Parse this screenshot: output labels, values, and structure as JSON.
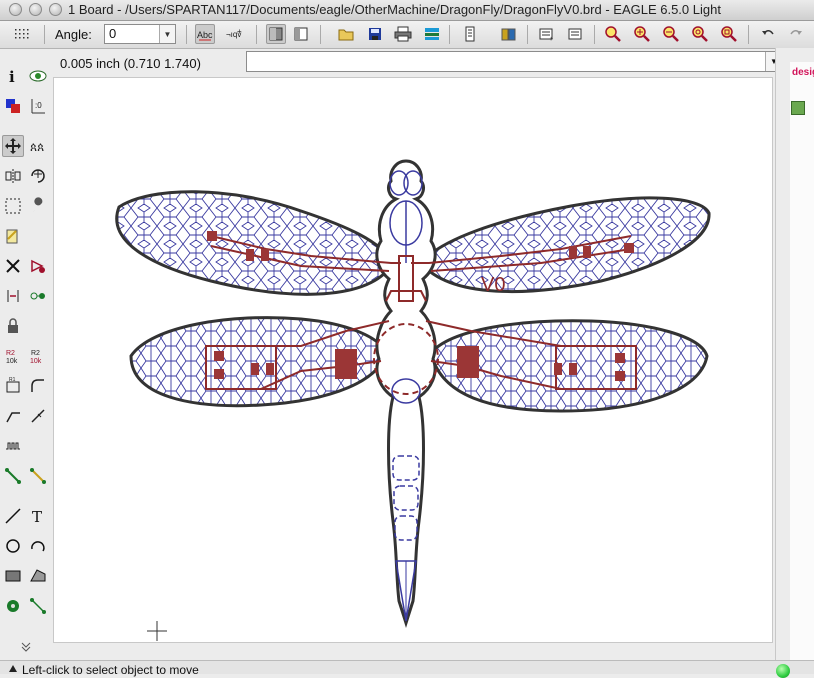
{
  "window": {
    "title": "1 Board - /Users/SPARTAN117/Documents/eagle/OtherMachine/DragonFly/DragonFlyV0.brd - EAGLE 6.5.0 Light"
  },
  "toolbar": {
    "angle_label": "Angle:",
    "angle_value": "0",
    "buttons": [
      "grid",
      "text-abc",
      "text-mirror",
      "layer-visible",
      "layer-settings",
      "open",
      "save",
      "print",
      "cam",
      "script",
      "ulp",
      "run",
      "zoom-fit",
      "zoom-in",
      "zoom-out",
      "zoom-redraw",
      "zoom-select",
      "undo",
      "redo"
    ]
  },
  "coordinate_display": "0.005 inch (0.710 1.740)",
  "command_line": {
    "value": ""
  },
  "canvas": {
    "board_label": "V0",
    "colors": {
      "outline": "#3a3a3a",
      "bottom_copper": "#3a3aa0",
      "top_copper": "#8e2a2a",
      "pad_fill": "#9b3636"
    }
  },
  "right_panel": {
    "link_text": "desig"
  },
  "status": {
    "message": "Left-click to select object to move"
  },
  "tools": [
    "info",
    "show",
    "display-layers",
    "mark",
    "move",
    "copy",
    "mirror",
    "rotate",
    "group",
    "change",
    "paste",
    "delete",
    "add",
    "pinswap",
    "replace",
    "lock",
    "name",
    "value",
    "smash",
    "miter",
    "split",
    "optimize",
    "meander",
    "route",
    "ripup",
    "wire",
    "text",
    "circle",
    "arc",
    "rect",
    "polygon",
    "via",
    "signal"
  ],
  "colors": {
    "status_led": "#2ecc40",
    "accent_link": "#d2145a"
  }
}
